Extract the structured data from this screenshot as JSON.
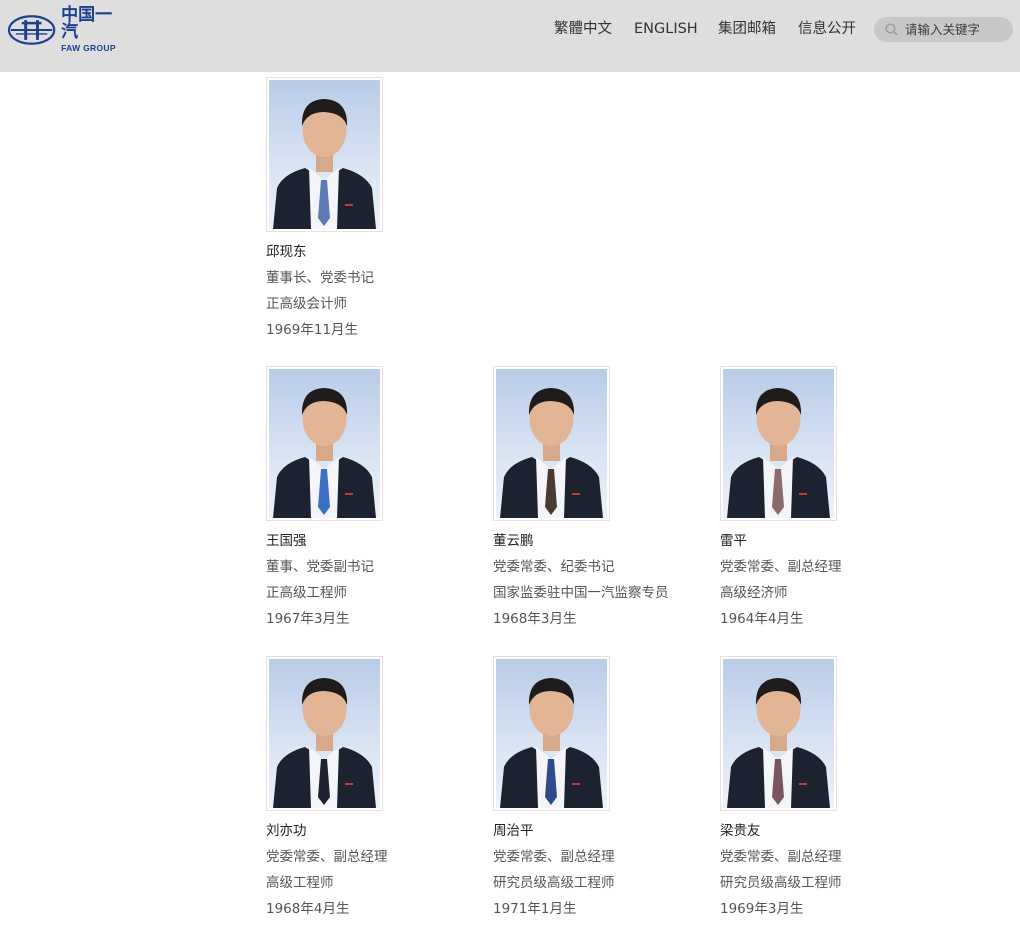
{
  "header": {
    "logo_cn": "中国一汽",
    "logo_en": "FAW GROUP",
    "nav": [
      "繁體中文",
      "ENGLISH",
      "集团邮箱",
      "信息公开"
    ],
    "search_placeholder": "请输入关键字"
  },
  "colors": {
    "header_bg": "#dedede",
    "brand_blue": "#1c3f8f",
    "search_bg": "#c8c8c8"
  },
  "leaders": [
    {
      "name": "邱现东",
      "title": "董事长、党委书记",
      "qualification": "正高级会计师",
      "born": "1969年11月生",
      "tie": "#5b7bb2"
    },
    {
      "name": "王国强",
      "title": "董事、党委副书记",
      "qualification": "正高级工程师",
      "born": "1967年3月生",
      "tie": "#3d6fc4"
    },
    {
      "name": "董云鹏",
      "title": "党委常委、纪委书记",
      "qualification": "国家监委驻中国一汽监察专员",
      "born": "1968年3月生",
      "tie": "#4a3b32"
    },
    {
      "name": "雷平",
      "title": "党委常委、副总经理",
      "qualification": "高级经济师",
      "born": "1964年4月生",
      "tie": "#8a6a6a"
    },
    {
      "name": "刘亦功",
      "title": "党委常委、副总经理",
      "qualification": "高级工程师",
      "born": "1968年4月生",
      "tie": "#1e2230"
    },
    {
      "name": "周治平",
      "title": "党委常委、副总经理",
      "qualification": "研究员级高级工程师",
      "born": "1971年1月生",
      "tie": "#2d4a8a"
    },
    {
      "name": "梁贵友",
      "title": "党委常委、副总经理",
      "qualification": "研究员级高级工程师",
      "born": "1969年3月生",
      "tie": "#7a5560"
    }
  ]
}
